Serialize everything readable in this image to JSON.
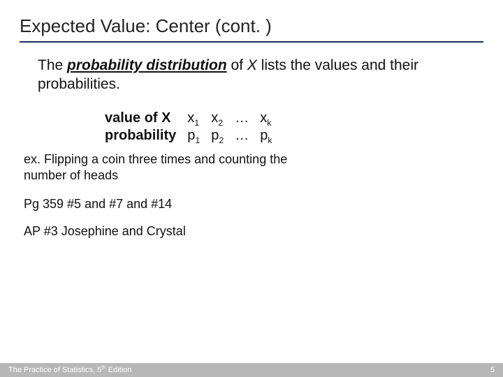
{
  "title": "Expected Value: Center (cont. )",
  "intro": {
    "before": "The ",
    "pd": "probability distribution",
    "mid": " of ",
    "xvar": "X",
    "after": " lists the values and their probabilities."
  },
  "table": {
    "row1_label": "value of X",
    "row2_label": "probability",
    "cells": {
      "x": "x",
      "p": "p",
      "s1": "1",
      "s2": "2",
      "sk": "k",
      "dots": "…"
    }
  },
  "example": "ex. Flipping a coin three times and counting the number of heads",
  "pg_line": "Pg 359 #5 and #7 and #14",
  "ap_line": "AP #3 Josephine and Crystal",
  "footer": {
    "left_a": "The Practice of Statistics, 5",
    "left_th": "th",
    "left_b": " Edition",
    "page": "5"
  }
}
